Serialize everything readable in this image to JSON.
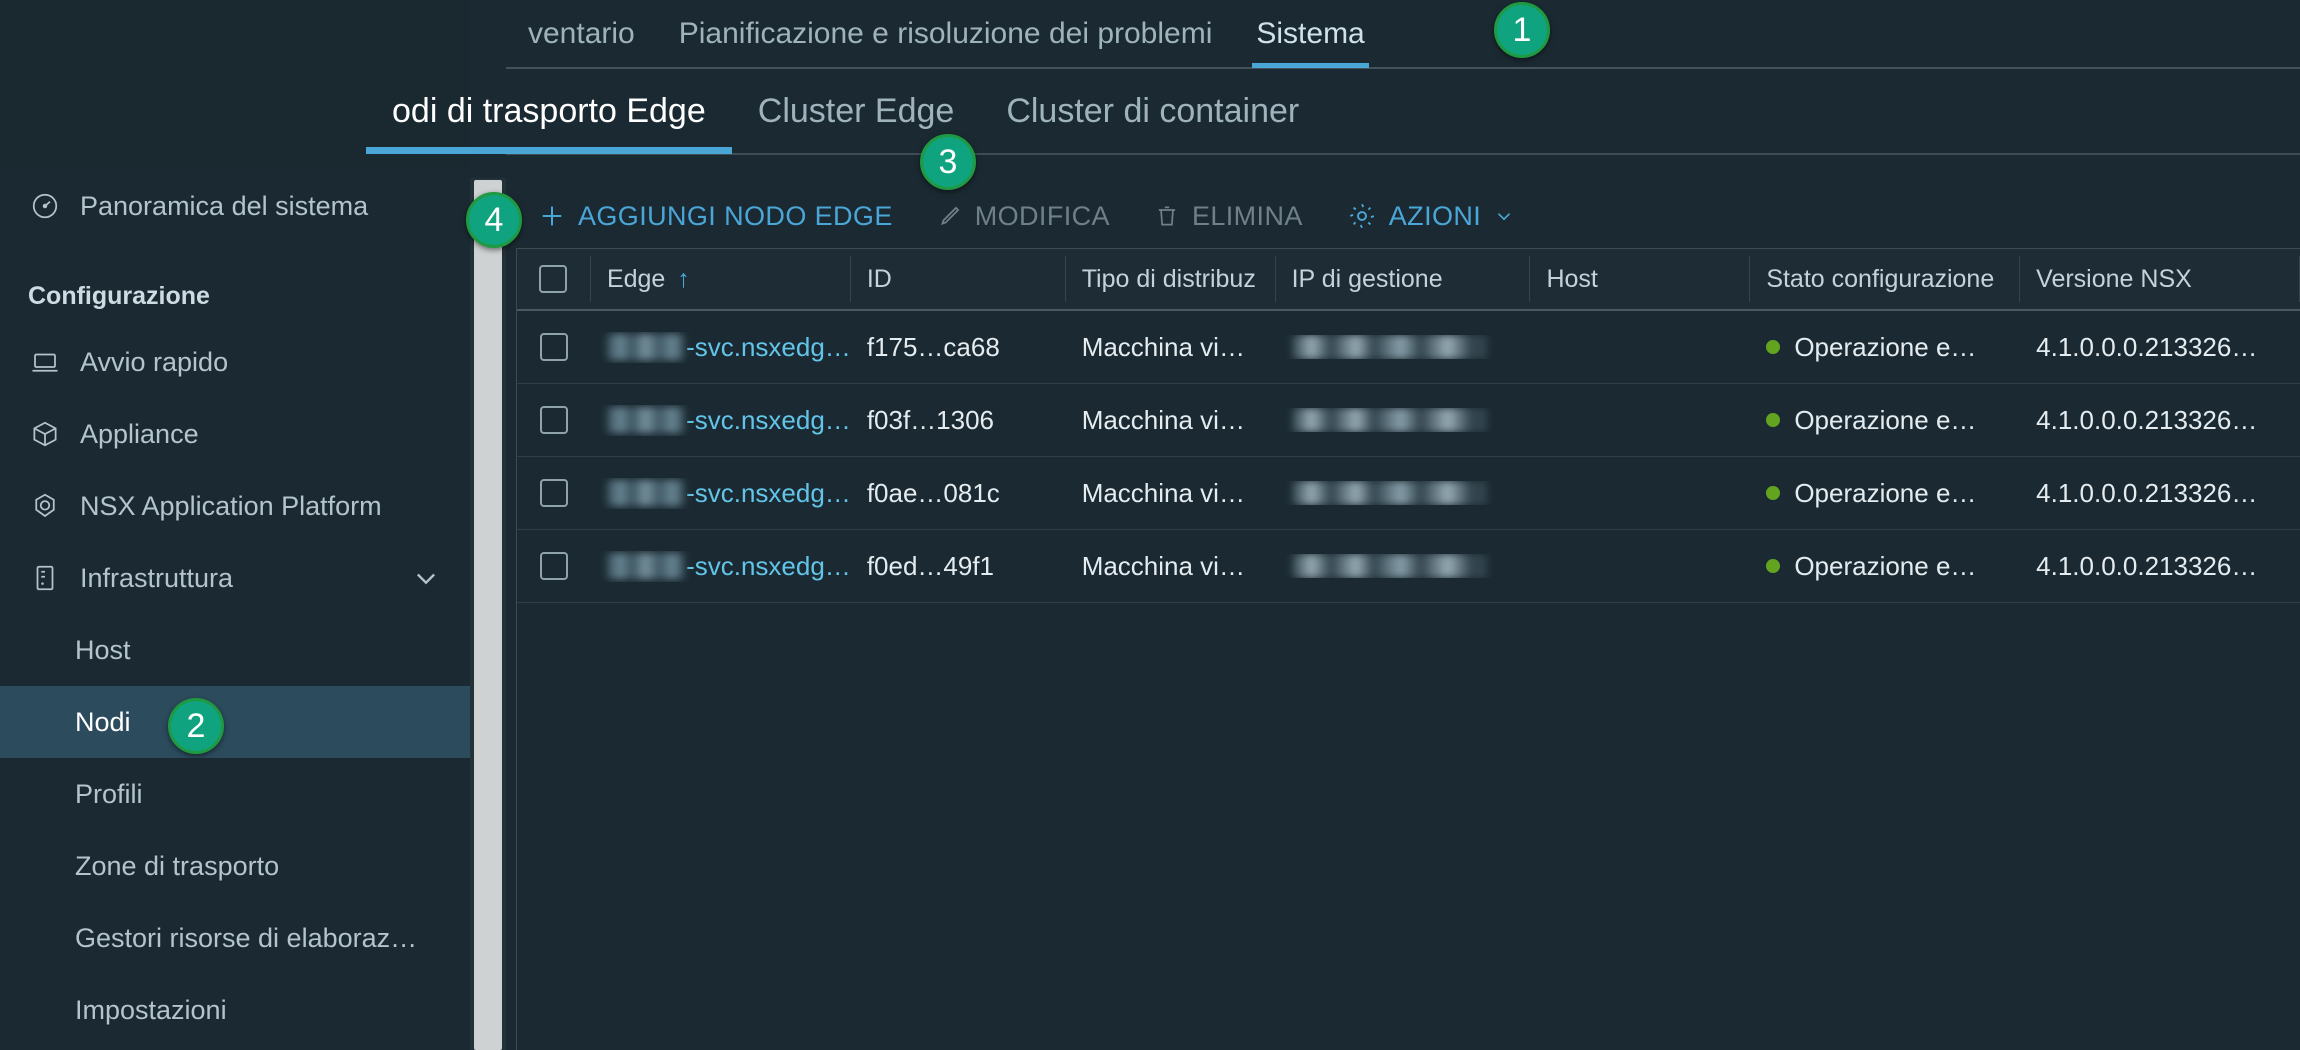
{
  "topnav": {
    "tabs": [
      {
        "label": "ventario",
        "active": false
      },
      {
        "label": "Pianificazione e risoluzione dei problemi",
        "active": false
      },
      {
        "label": "Sistema",
        "active": true
      }
    ]
  },
  "subnav": {
    "tabs": [
      {
        "label": "odi di trasporto Edge",
        "active": true
      },
      {
        "label": "Cluster Edge",
        "active": false
      },
      {
        "label": "Cluster di container",
        "active": false
      }
    ]
  },
  "sidebar": {
    "overview": {
      "label": "Panoramica del sistema",
      "icon": "gauge-icon"
    },
    "section_title": "Configurazione",
    "items": [
      {
        "label": "Avvio rapido",
        "icon": "laptop-icon"
      },
      {
        "label": "Appliance",
        "icon": "cube-icon"
      },
      {
        "label": "NSX Application Platform",
        "icon": "polygon-icon"
      },
      {
        "label": "Infrastruttura",
        "icon": "server-icon",
        "expandable": true
      }
    ],
    "subitems": [
      {
        "label": "Host",
        "selected": false
      },
      {
        "label": "Nodi",
        "selected": true,
        "badge": "2"
      },
      {
        "label": "Profili",
        "selected": false
      },
      {
        "label": "Zone di trasporto",
        "selected": false
      },
      {
        "label": "Gestori risorse di elaboraz…",
        "selected": false
      },
      {
        "label": "Impostazioni",
        "selected": false
      }
    ]
  },
  "toolbar": {
    "add_label": "AGGIUNGI NODO EDGE",
    "edit_label": "MODIFICA",
    "delete_label": "ELIMINA",
    "actions_label": "AZIONI",
    "add_icon": "plus-icon",
    "edit_icon": "pencil-icon",
    "delete_icon": "trash-icon",
    "actions_icon": "gear-icon",
    "actions_caret": "chevron-down-icon"
  },
  "table": {
    "headers": {
      "edge": "Edge",
      "sort_arrow": "↑",
      "id": "ID",
      "type": "Tipo di distribuz",
      "ip": "IP di gestione",
      "host": "Host",
      "status": "Stato configurazione",
      "version": "Versione NSX"
    },
    "rows": [
      {
        "edge_suffix": "-svc.nsxedg…",
        "id": "f175…ca68",
        "type": "Macchina vi…",
        "ip": "",
        "host": "",
        "status": "Operazione e…",
        "version": "4.1.0.0.0.213326…"
      },
      {
        "edge_suffix": "-svc.nsxedg…",
        "id": "f03f…1306",
        "type": "Macchina vi…",
        "ip": "",
        "host": "",
        "status": "Operazione e…",
        "version": "4.1.0.0.0.213326…"
      },
      {
        "edge_suffix": "-svc.nsxedg…",
        "id": "f0ae…081c",
        "type": "Macchina vi…",
        "ip": "",
        "host": "",
        "status": "Operazione e…",
        "version": "4.1.0.0.0.213326…"
      },
      {
        "edge_suffix": "-svc.nsxedg…",
        "id": "f0ed…49f1",
        "type": "Macchina vi…",
        "ip": "",
        "host": "",
        "status": "Operazione e…",
        "version": "4.1.0.0.0.213326…"
      }
    ]
  },
  "badges": {
    "b1": "1",
    "b2": "2",
    "b3": "3",
    "b4": "4"
  },
  "colors": {
    "background": "#1b2a32",
    "accent": "#4ba6d8",
    "link": "#62c4e8",
    "badge_fill": "#10a37f",
    "badge_ring": "#1f9a42",
    "status_ok": "#62a420",
    "selected_row": "#2c4c5e"
  }
}
